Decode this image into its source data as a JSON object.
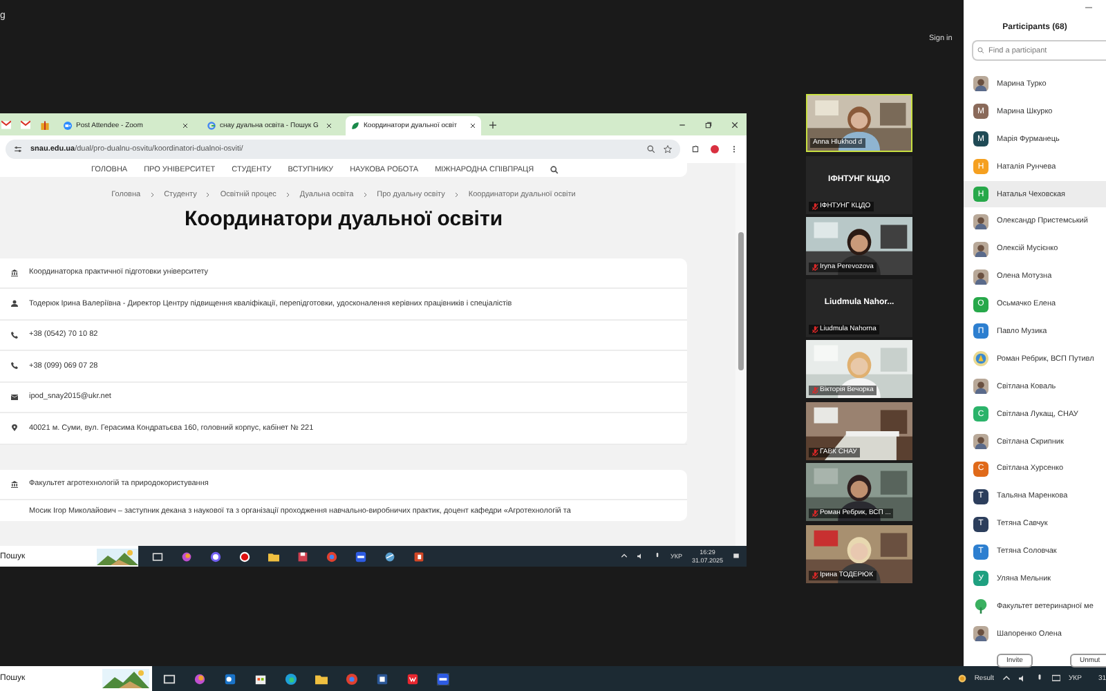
{
  "top_bar": {
    "fragment": "g",
    "sign_in": "Sign in"
  },
  "browser": {
    "tabs": [
      {
        "title": "Post Attendee - Zoom",
        "selected": false
      },
      {
        "title": "снау дуальна освіта - Пошук G",
        "selected": false
      },
      {
        "title": "Координатори дуальної освіт",
        "selected": true
      }
    ],
    "address": "**snau.edu.ua**/dual/pro-dualnu-osvitu/koordinatori-dualnoi-osviti/",
    "nav": [
      "ГОЛОВНА",
      "ПРО УНІВЕРСИТЕТ",
      "СТУДЕНТУ",
      "ВСТУПНИКУ",
      "НАУКОВА РОБОТА",
      "МІЖНАРОДНА СПІВПРАЦЯ"
    ],
    "breadcrumbs": [
      "Головна",
      "Студенту",
      "Освітній процес",
      "Дуальна освіта",
      "Про дуальну освіту",
      "Координатори дуальної освіти"
    ],
    "title": "Координатори дуальної освіти",
    "cards": [
      {
        "rows": [
          {
            "kind": "institution",
            "text": "Координаторка практичної підготовки університету"
          },
          {
            "kind": "person",
            "text": "Тодерюк Ірина Валеріївна - Директор Центру підвищення кваліфікації, перепідготовки, удосконалення керівних працівників і спеціалістів"
          },
          {
            "kind": "phone",
            "text": "+38 (0542) 70 10 82"
          },
          {
            "kind": "phone",
            "text": "+38 (099) 069 07 28"
          },
          {
            "kind": "email",
            "text": "ipod_snay2015@ukr.net"
          },
          {
            "kind": "location",
            "text": "40021 м. Суми, вул. Герасима Кондратьєва 160, головний корпус, кабінет № 221"
          }
        ]
      },
      {
        "rows": [
          {
            "kind": "institution",
            "text": "Факультет агротехнологій та природокористування"
          },
          {
            "kind": "none",
            "text": "Мосик Ігор Миколайович – заступник декана з наукової та з організації проходження навчально-виробничих практик, доцент кафедри «Агротехнологій та"
          }
        ]
      }
    ],
    "taskbar": {
      "search": "Пошук",
      "language": "УКР",
      "time": "16:29",
      "date": "31.07.2025"
    }
  },
  "videos": [
    {
      "kind": "video",
      "label": "Anna Hlukhod d",
      "muted": false,
      "speaking": true
    },
    {
      "kind": "name",
      "display": "ІФНТУНГ КЦДО",
      "label": "ІФНТУНГ КЦДО",
      "muted": true,
      "speaking": false
    },
    {
      "kind": "video",
      "label": "Iryna Perevozova",
      "muted": true,
      "speaking": false
    },
    {
      "kind": "name",
      "display": "Liudmula  Nahor...",
      "label": "Liudmula Nahorna",
      "muted": true,
      "speaking": false
    },
    {
      "kind": "video",
      "label": "Вікторія Вечорка",
      "muted": true,
      "speaking": false
    },
    {
      "kind": "video",
      "label": "ГАВК СНАУ",
      "muted": true,
      "speaking": false
    },
    {
      "kind": "video",
      "label": "Роман Ребрик, ВСП ...",
      "muted": true,
      "speaking": false
    },
    {
      "kind": "video",
      "label": "Ірина ТОДЕРЮК",
      "muted": true,
      "speaking": false
    }
  ],
  "participants": {
    "title": "Participants (68)",
    "search": {
      "placeholder": "Find a participant"
    },
    "items": [
      {
        "name": "Марина Турко",
        "selected": false
      },
      {
        "name": "Марина Шкурко",
        "kind": "letter",
        "letter": "М",
        "color": "#8a6a5a",
        "selected": false
      },
      {
        "name": "Марія Фурманець",
        "kind": "letter",
        "letter": "М",
        "color": "#1f4a55",
        "selected": false
      },
      {
        "name": "Наталія Рунчева",
        "kind": "letter",
        "letter": "Н",
        "color": "#f5a020",
        "selected": false
      },
      {
        "name": "Наталья Чеховская",
        "kind": "letter",
        "letter": "Н",
        "color": "#27a84a",
        "selected": true
      },
      {
        "name": "Олександр Пристемський",
        "selected": false
      },
      {
        "name": "Олексій Мусієнко",
        "selected": false
      },
      {
        "name": "Олена Мотузна",
        "selected": false
      },
      {
        "name": "Осьмачко Елена",
        "kind": "letter",
        "letter": "О",
        "color": "#27a84a",
        "selected": false
      },
      {
        "name": "Павло Музика",
        "kind": "letter",
        "letter": "П",
        "color": "#2d7fd0",
        "selected": false
      },
      {
        "name": "Роман Ребрик, ВСП Путивл",
        "kind": "logo",
        "selected": false
      },
      {
        "name": "Світлана Коваль",
        "selected": false
      },
      {
        "name": "Світлана Лукащ, СНАУ",
        "kind": "letter",
        "letter": "С",
        "color": "#2bb36a",
        "selected": false
      },
      {
        "name": "Світлана Скрипник",
        "selected": false
      },
      {
        "name": "Світлана Хурсенко",
        "kind": "letter",
        "letter": "С",
        "color": "#e06a1a",
        "selected": false
      },
      {
        "name": "Тальяна Маренкова",
        "kind": "letter",
        "letter": "Т",
        "color": "#2c3e5c",
        "selected": false
      },
      {
        "name": "Тетяна Савчук",
        "kind": "letter",
        "letter": "Т",
        "color": "#2c3e5c",
        "selected": false
      },
      {
        "name": "Тетяна Соловчак",
        "kind": "letter",
        "letter": "Т",
        "color": "#2d7fd0",
        "selected": false
      },
      {
        "name": "Уляна Мельник",
        "kind": "letter",
        "letter": "У",
        "color": "#1fa080",
        "selected": false
      },
      {
        "name": "Факультет ветеринарної ме",
        "kind": "tree",
        "selected": false
      },
      {
        "name": "Шапоренко Олена",
        "selected": false
      }
    ],
    "buttons": [
      "Invite",
      "Unmut"
    ]
  },
  "taskbar": {
    "search": "Пошук",
    "weather": "Result",
    "language": "УКР",
    "date": "31"
  }
}
